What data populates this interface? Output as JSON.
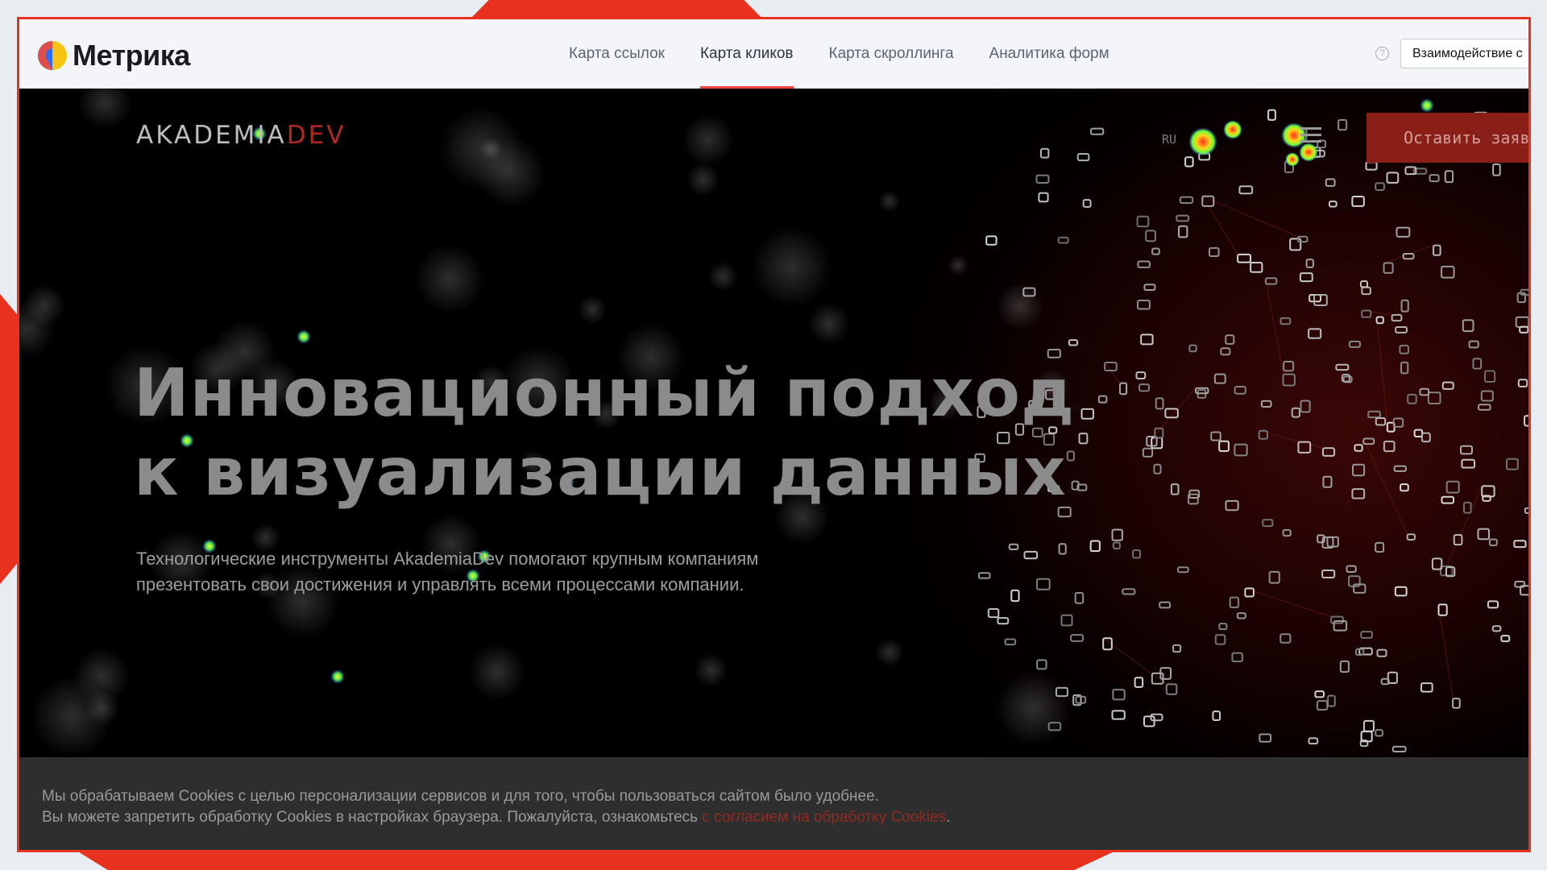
{
  "metrika": {
    "logo_text": "Метрика",
    "tabs": [
      {
        "label": "Карта ссылок",
        "active": false
      },
      {
        "label": "Карта кликов",
        "active": true
      },
      {
        "label": "Карта скроллинга",
        "active": false
      },
      {
        "label": "Аналитика форм",
        "active": false
      }
    ],
    "help_icon": "?",
    "interaction_button": "Взаимодействие с"
  },
  "site": {
    "logo_main": "AKADEMIA",
    "logo_accent": "DEV",
    "lang": "RU",
    "cta_label": "Оставить заяв",
    "hero_title_line1": "Инновационный подход",
    "hero_title_line2": "к визуализации данных",
    "hero_subtitle_line1": "Технологические инструменты AkademiaDev помогают крупным компаниям",
    "hero_subtitle_line2": "презентовать свои достижения и управлять всеми процессами компании."
  },
  "cookie": {
    "line1": "Мы обрабатываем Cookies с целью персонализации сервисов и для того, чтобы пользоваться сайтом было удобнее.",
    "line2_prefix": "Вы можете запретить обработку Cookies в настройках браузера. Пожалуйста, ознакомьтесь ",
    "line2_link": "с согласием на обработку Cookies",
    "line2_suffix": "."
  },
  "colors": {
    "accent_red": "#e8321e",
    "tab_underline": "#f2453d",
    "heat_low": "#2d5cff",
    "heat_mid": "#d8ff2a",
    "heat_high": "#ff2a1a"
  }
}
